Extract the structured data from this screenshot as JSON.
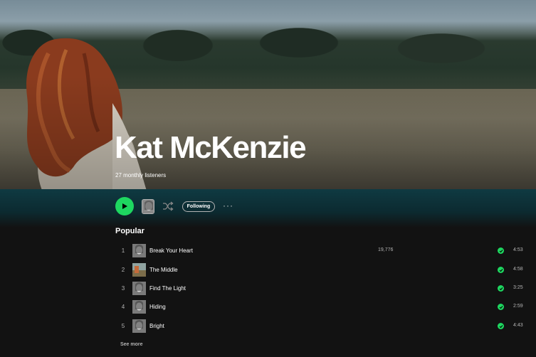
{
  "artist": {
    "name": "Kat McKenzie",
    "listeners": "27 monthly listeners"
  },
  "actions": {
    "follow_label": "Following",
    "more_label": "···"
  },
  "popular": {
    "title": "Popular",
    "tracks": [
      {
        "num": "1",
        "title": "Break Your Heart",
        "plays": "19,776",
        "duration": "4:53"
      },
      {
        "num": "2",
        "title": "The Middle",
        "plays": "",
        "duration": "4:58"
      },
      {
        "num": "3",
        "title": "Find The Light",
        "plays": "",
        "duration": "3:25"
      },
      {
        "num": "4",
        "title": "Hiding",
        "plays": "",
        "duration": "2:59"
      },
      {
        "num": "5",
        "title": "Bright",
        "plays": "",
        "duration": "4:43"
      }
    ],
    "see_more": "See more"
  },
  "colors": {
    "accent": "#1ed760",
    "background": "#121212"
  }
}
